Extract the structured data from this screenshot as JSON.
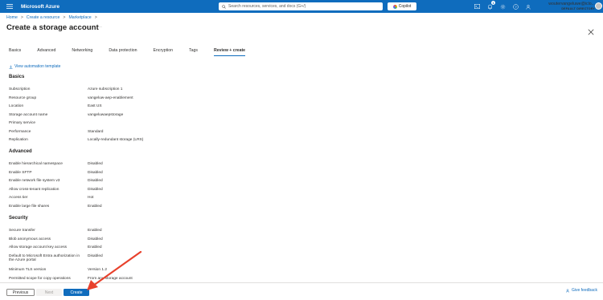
{
  "topbar": {
    "brand": "Microsoft Azure",
    "search_placeholder": "Search resources, services, and docs (G+/)",
    "copilot_label": "Copilot",
    "notification_count": "1",
    "user_email": "woutervangeluwe@iclo...",
    "user_directory": "DEFAULT DIRECTORY"
  },
  "breadcrumb": [
    "Home",
    "Create a resource",
    "Marketplace"
  ],
  "page_title": "Create a storage account",
  "tabs": [
    "Basics",
    "Advanced",
    "Networking",
    "Data protection",
    "Encryption",
    "Tags",
    "Review + create"
  ],
  "automation_link": "View automation template",
  "sections": {
    "basics": {
      "title": "Basics",
      "rows": [
        {
          "k": "Subscription",
          "v": "Azure subscription 1"
        },
        {
          "k": "Resource group",
          "v": "vangeluw-aep-enablement"
        },
        {
          "k": "Location",
          "v": "East US"
        },
        {
          "k": "Storage account name",
          "v": "vangeluwaepstorage"
        },
        {
          "k": "Primary service",
          "v": ""
        },
        {
          "k": "Performance",
          "v": "Standard"
        },
        {
          "k": "Replication",
          "v": "Locally-redundant storage (LRS)"
        }
      ]
    },
    "advanced": {
      "title": "Advanced",
      "rows": [
        {
          "k": "Enable hierarchical namespace",
          "v": "Disabled"
        },
        {
          "k": "Enable SFTP",
          "v": "Disabled"
        },
        {
          "k": "Enable network file system v3",
          "v": "Disabled"
        },
        {
          "k": "Allow cross-tenant replication",
          "v": "Disabled"
        },
        {
          "k": "Access tier",
          "v": "Hot"
        },
        {
          "k": "Enable large file shares",
          "v": "Enabled"
        }
      ]
    },
    "security": {
      "title": "Security",
      "rows": [
        {
          "k": "Secure transfer",
          "v": "Enabled"
        },
        {
          "k": "Blob anonymous access",
          "v": "Disabled"
        },
        {
          "k": "Allow storage account key access",
          "v": "Enabled"
        },
        {
          "k": "Default to Microsoft Entra authorization in the Azure portal",
          "v": "Disabled"
        },
        {
          "k": "Minimum TLS version",
          "v": "Version 1.2"
        },
        {
          "k": "Permitted scope for copy operations",
          "v": "From any storage account"
        }
      ]
    }
  },
  "footer": {
    "previous": "Previous",
    "next": "Next",
    "create": "Create",
    "feedback": "Give feedback"
  },
  "colors": {
    "accent": "#0f6cbd",
    "annotation_arrow": "#e8412c"
  }
}
